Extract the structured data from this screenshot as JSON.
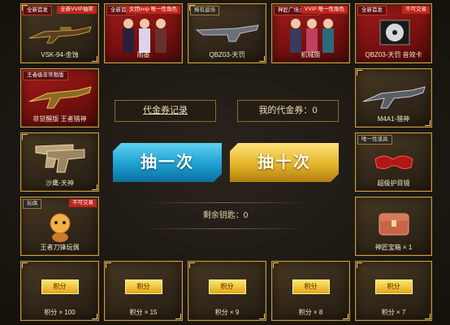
{
  "top_row": [
    {
      "tag": "全新首发",
      "tag2": "全新VVIP抽奖",
      "label": "VSK-94-金蚀"
    },
    {
      "tag": "全新首发",
      "tag2": "女团vvip 唯一性角色",
      "label": "雨墨"
    },
    {
      "tag": "稀有返场",
      "tag2": "",
      "label": "QBZ03-天罚"
    },
    {
      "tag": "神匠广场主题人",
      "tag2": "VVIP 唯一性角色",
      "label": "机械姬"
    },
    {
      "tag": "全新首发",
      "tag2": "不可交易",
      "label": "QBZ03-天罚 音效卡"
    }
  ],
  "left_col": [
    {
      "tag": "王者级非常限版",
      "label": "非觉醒版 王者猎神"
    },
    {
      "tag": "",
      "label": "沙鹰-天神"
    },
    {
      "tag": "玩偶",
      "tag2": "不可交易",
      "label": "王者刀锋玩偶"
    }
  ],
  "right_col": [
    {
      "tag": "",
      "label": "M4A1-猎神"
    },
    {
      "tag": "唯一性道具",
      "label": "超级护目镜"
    },
    {
      "tag": "",
      "label": "神匠宝箱 × 1"
    }
  ],
  "bottom_row": [
    {
      "coin": "积分",
      "label": "积分 × 100"
    },
    {
      "coin": "积分",
      "label": "积分 × 15"
    },
    {
      "coin": "积分",
      "label": "积分 × 9"
    },
    {
      "coin": "积分",
      "label": "积分 × 8"
    },
    {
      "coin": "积分",
      "label": "积分 × 7"
    }
  ],
  "center": {
    "record_btn": "代金券记录",
    "coupon_label": "我的代金券：",
    "coupon_value": "0",
    "draw_one": "抽一次",
    "draw_ten": "抽十次",
    "keys_label": "剩余钥匙：",
    "keys_value": "0"
  }
}
